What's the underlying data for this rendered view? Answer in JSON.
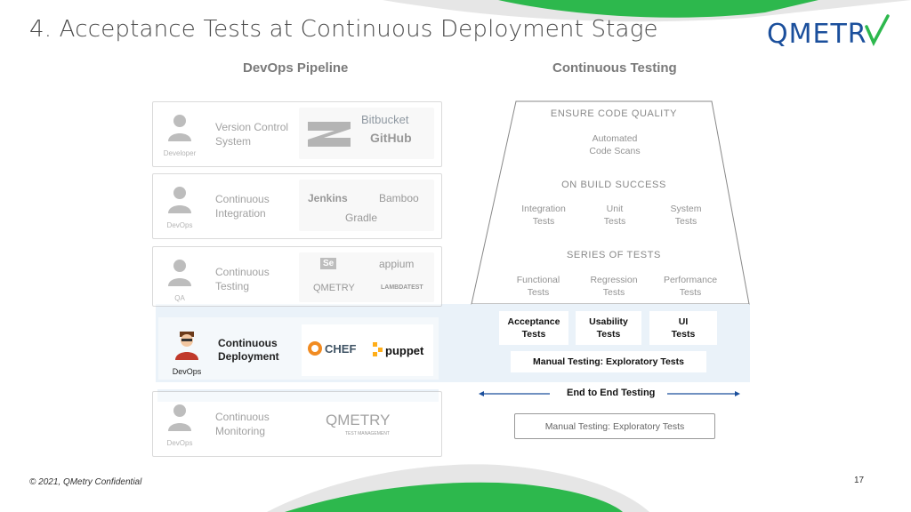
{
  "slide_title": "4. Acceptance Tests at Continuous Deployment Stage",
  "logo_text": "QMETRY",
  "colors": {
    "green": "#2db84d",
    "blue": "#1b4f9c",
    "band": "#eaf2f9",
    "arrow": "#1b4f9c"
  },
  "pipeline": {
    "heading": "DevOps Pipeline",
    "stages": [
      {
        "role": "Developer",
        "label_l1": "Version Control",
        "label_l2": "System",
        "tools": [
          "Bitbucket",
          "GitHub"
        ]
      },
      {
        "role": "DevOps",
        "label_l1": "Continuous",
        "label_l2": "Integration",
        "tools": [
          "Jenkins",
          "Bamboo",
          "Gradle"
        ]
      },
      {
        "role": "QA",
        "label_l1": "Continuous",
        "label_l2": "Testing",
        "tools": [
          "Se",
          "appium",
          "QMETRY",
          "LAMBDATEST"
        ]
      },
      {
        "role": "DevOps",
        "label_l1": "Continuous",
        "label_l2": "Deployment",
        "tools": [
          "CHEF",
          "puppet"
        ]
      },
      {
        "role": "DevOps",
        "label_l1": "Continuous",
        "label_l2": "Monitoring",
        "tools": [
          "QMETRY",
          "TEST MANAGEMENT"
        ]
      }
    ]
  },
  "testing": {
    "heading": "Continuous Testing",
    "sections": [
      {
        "label": "ENSURE CODE QUALITY",
        "boxes": [
          [
            "Automated",
            "Code Scans"
          ]
        ]
      },
      {
        "label": "ON BUILD SUCCESS",
        "boxes": [
          [
            "Integration",
            "Tests"
          ],
          [
            "Unit",
            "Tests"
          ],
          [
            "System",
            "Tests"
          ]
        ]
      },
      {
        "label": "SERIES OF TESTS",
        "boxes": [
          [
            "Functional",
            "Tests"
          ],
          [
            "Regression",
            "Tests"
          ],
          [
            "Performance",
            "Tests"
          ]
        ]
      }
    ],
    "highlight_boxes": [
      [
        "Acceptance",
        "Tests"
      ],
      [
        "Usability",
        "Tests"
      ],
      [
        "UI",
        "Tests"
      ]
    ],
    "manual_highlight": "Manual Testing: Exploratory Tests",
    "end_to_end": "End to End Testing",
    "manual_bottom": "Manual Testing: Exploratory Tests"
  },
  "footer": "© 2021, QMetry Confidential",
  "page_number": "17"
}
